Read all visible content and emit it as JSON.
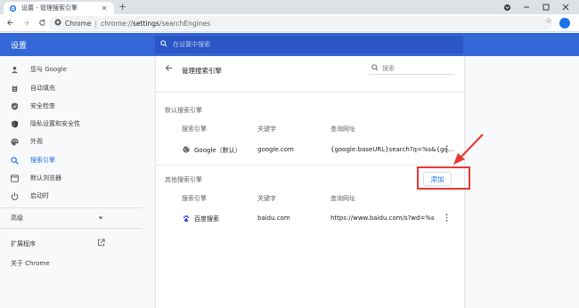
{
  "browser": {
    "tab_title": "设置 - 管理搜索引擎",
    "tab_close": "✕",
    "new_tab": "+",
    "omnibox_label": "Chrome",
    "omnibox_sep": "|",
    "url_prefix": "chrome://",
    "url_host": "settings",
    "url_path": "/searchEngines"
  },
  "header": {
    "title": "设置",
    "search_placeholder": "在设置中搜索"
  },
  "sidebar": {
    "items": [
      {
        "label": "您与 Google",
        "icon": "person-icon"
      },
      {
        "label": "自动填充",
        "icon": "clipboard-icon"
      },
      {
        "label": "安全检查",
        "icon": "shield-icon"
      },
      {
        "label": "隐私设置和安全性",
        "icon": "privacy-shield-icon"
      },
      {
        "label": "外观",
        "icon": "palette-icon"
      },
      {
        "label": "搜索引擎",
        "icon": "search-icon"
      },
      {
        "label": "默认浏览器",
        "icon": "browser-icon"
      },
      {
        "label": "启动时",
        "icon": "power-icon"
      }
    ],
    "advanced": "高级",
    "extensions": "扩展程序",
    "about": "关于 Chrome"
  },
  "main": {
    "title": "管理搜索引擎",
    "search_placeholder": "搜索",
    "default_section": "默认搜索引擎",
    "other_section": "其他搜索引擎",
    "columns": [
      "搜索引擎",
      "关键字",
      "查询网址"
    ],
    "default_engines": [
      {
        "name": "Google（默认）",
        "keyword": "google.com",
        "url": "{google:baseURL}search?q=%s&{go..."
      }
    ],
    "other_engines": [
      {
        "name": "百度搜索",
        "keyword": "baidu.com",
        "url": "https://www.baidu.com/s?wd=%s"
      }
    ],
    "add_button": "添加"
  },
  "colors": {
    "header_bg": "#3367d6",
    "accent": "#1a73e8",
    "annotation": "#e53935"
  }
}
